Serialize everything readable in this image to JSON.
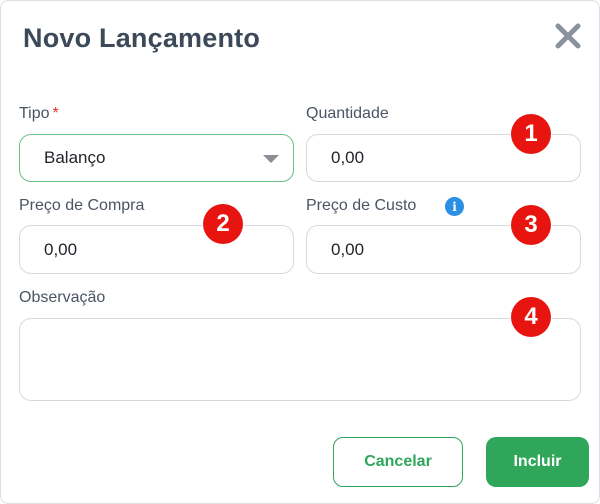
{
  "dialog": {
    "title": "Novo Lançamento",
    "close_icon": "close-x-icon"
  },
  "form": {
    "tipo": {
      "label": "Tipo",
      "required_mark": "*",
      "value": "Balanço"
    },
    "quantidade": {
      "label": "Quantidade",
      "value": "0,00"
    },
    "preco_compra": {
      "label": "Preço de Compra",
      "value": "0,00"
    },
    "preco_custo": {
      "label": "Preço de Custo",
      "value": "0,00",
      "info_icon": "info-icon"
    },
    "observacao": {
      "label": "Observação",
      "value": ""
    }
  },
  "badges": [
    "1",
    "2",
    "3",
    "4"
  ],
  "buttons": {
    "cancel_label": "Cancelar",
    "submit_label": "Incluir"
  },
  "colors": {
    "accent_green": "#2fa65a",
    "badge_red": "#e8140f",
    "info_blue": "#2b8fe3"
  }
}
